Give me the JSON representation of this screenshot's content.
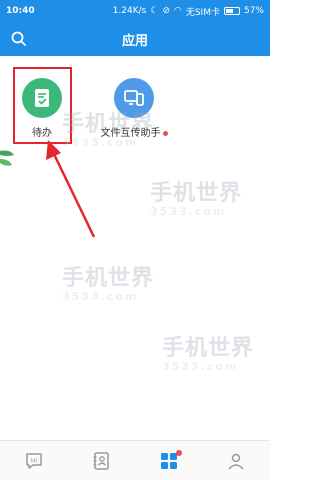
{
  "status_bar": {
    "time": "10:40",
    "speed": "1.24K/s",
    "carrier": "无SIM卡",
    "battery": "57%",
    "battery_level": 0.57
  },
  "app_bar": {
    "title": "应用"
  },
  "apps": [
    {
      "label": "待办",
      "icon": "todo-check-icon",
      "color": "#3cb97a"
    },
    {
      "label": "文件互传助手",
      "icon": "file-transfer-icon",
      "color": "#4f9be8",
      "has_red_dot": true
    }
  ],
  "watermark": {
    "main": "手机世界",
    "sub": "3533.com"
  },
  "tabs": [
    {
      "name": "messages",
      "icon": "chat-hi-icon",
      "badge_text": "Hi"
    },
    {
      "name": "contacts",
      "icon": "contacts-book-icon"
    },
    {
      "name": "apps",
      "icon": "apps-grid-icon",
      "active": true,
      "has_badge": true
    },
    {
      "name": "me",
      "icon": "person-icon"
    }
  ],
  "colors": {
    "primary": "#1f8ee6",
    "highlight": "#e4262c",
    "inactive_icon": "#9a9a9a"
  }
}
